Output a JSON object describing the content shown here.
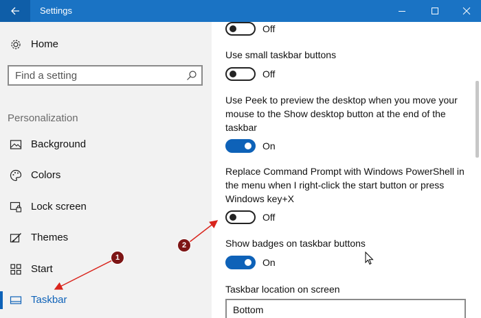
{
  "window": {
    "title": "Settings",
    "back_icon": "back-arrow-icon",
    "titlebar_color": "#1a73c4"
  },
  "sidebar": {
    "home_label": "Home",
    "search_placeholder": "Find a setting",
    "section_header": "Personalization",
    "items": [
      {
        "label": "Background",
        "icon": "picture-icon"
      },
      {
        "label": "Colors",
        "icon": "palette-icon"
      },
      {
        "label": "Lock screen",
        "icon": "lock-screen-icon"
      },
      {
        "label": "Themes",
        "icon": "themes-icon"
      },
      {
        "label": "Start",
        "icon": "start-icon"
      },
      {
        "label": "Taskbar",
        "icon": "taskbar-icon",
        "active": true
      }
    ],
    "accent_color": "#0e62b8"
  },
  "main": {
    "settings": [
      {
        "label": "",
        "state": "Off",
        "on": false
      },
      {
        "label": "Use small taskbar buttons",
        "state": "Off",
        "on": false
      },
      {
        "label": "Use Peek to preview the desktop when you move your mouse to the Show desktop button at the end of the taskbar",
        "state": "On",
        "on": true
      },
      {
        "label": "Replace Command Prompt with Windows PowerShell in the menu when I right-click the start button or press Windows key+X",
        "state": "Off",
        "on": false
      },
      {
        "label": "Show badges on taskbar buttons",
        "state": "On",
        "on": true
      }
    ],
    "location_label": "Taskbar location on screen",
    "location_value": "Bottom"
  },
  "annotations": [
    {
      "number": "1",
      "color": "#7d1515"
    },
    {
      "number": "2",
      "color": "#7d1515"
    }
  ]
}
